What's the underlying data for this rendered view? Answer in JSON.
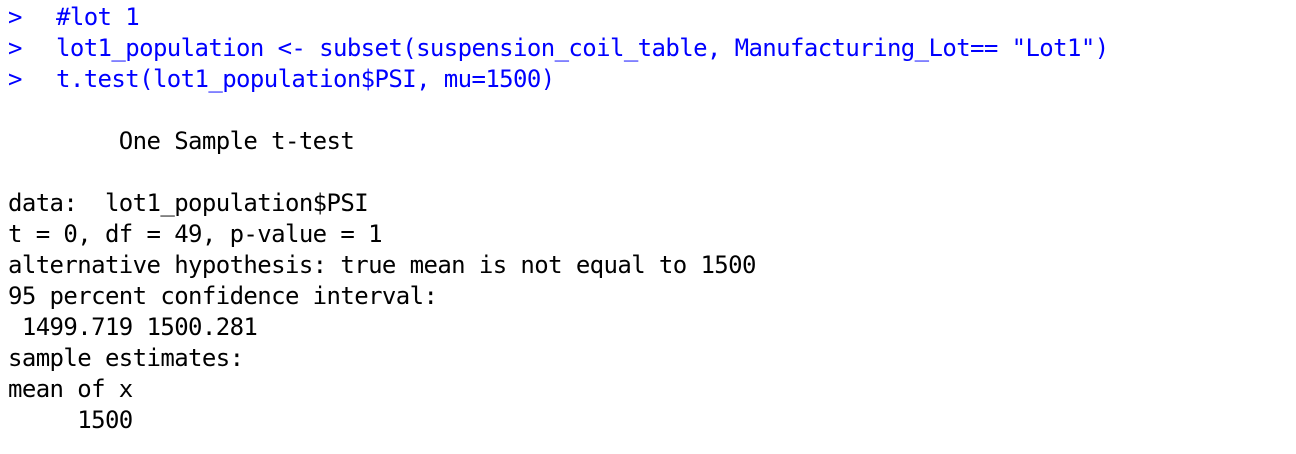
{
  "console": {
    "prompt": ">",
    "commands": [
      "#lot 1",
      "lot1_population <- subset(suspension_coil_table, Manufacturing_Lot== \"Lot1\")",
      "t.test(lot1_population$PSI, mu=1500)"
    ],
    "output": {
      "title": "        One Sample t-test",
      "data_line": "data:  lot1_population$PSI",
      "stats_line": "t = 0, df = 49, p-value = 1",
      "alternative": "alternative hypothesis: true mean is not equal to 1500",
      "ci_label": "95 percent confidence interval:",
      "ci_values": " 1499.719 1500.281",
      "estimates_label": "sample estimates:",
      "estimate_name": "mean of x",
      "estimate_value": "     1500"
    },
    "colors": {
      "command": "#0000ff",
      "output": "#000000"
    }
  }
}
